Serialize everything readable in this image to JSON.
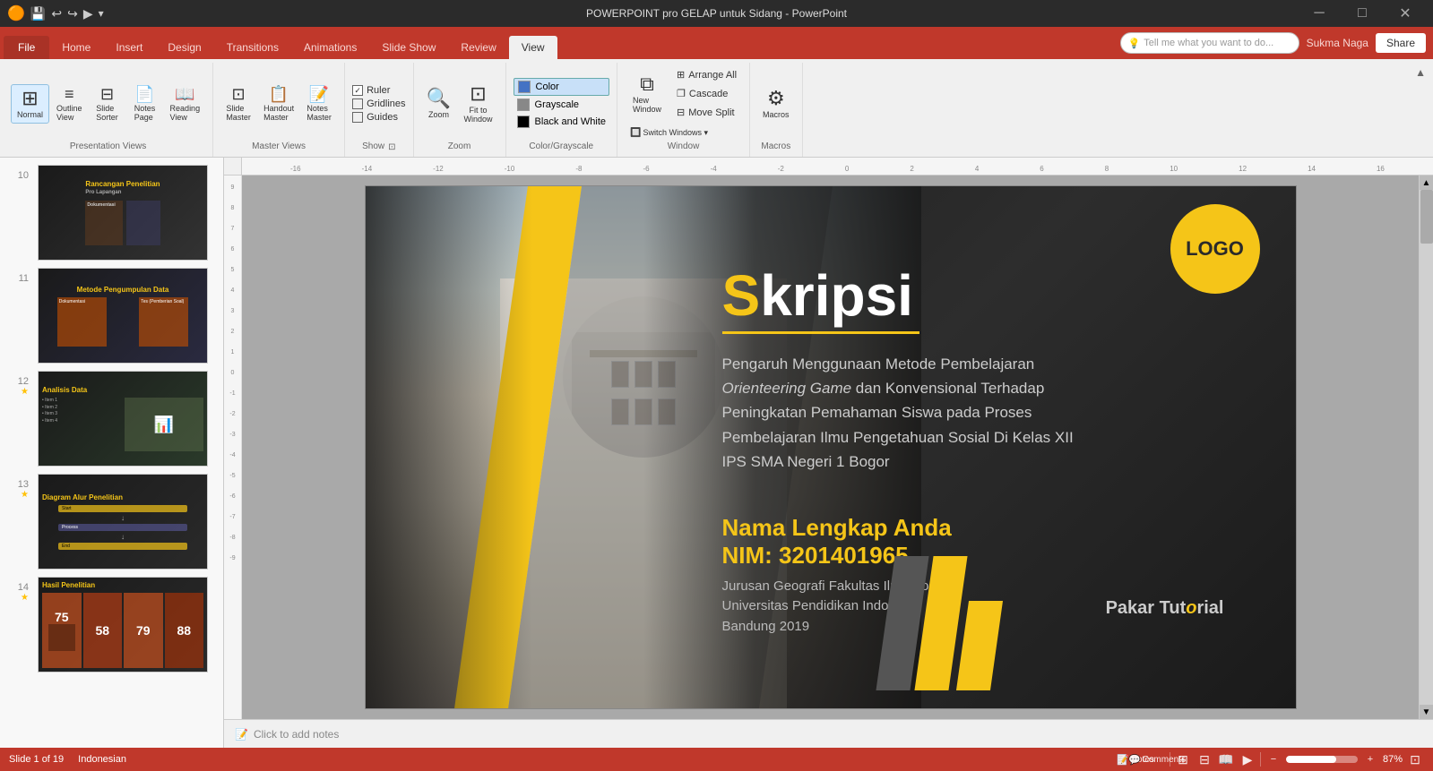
{
  "titlebar": {
    "title": "POWERPOINT pro GELAP untuk Sidang - PowerPoint",
    "minimize": "─",
    "maximize": "□",
    "close": "✕"
  },
  "ribbon": {
    "tabs": [
      "File",
      "Home",
      "Insert",
      "Design",
      "Transitions",
      "Animations",
      "Slide Show",
      "Review",
      "View"
    ],
    "active_tab": "View",
    "tell_me": "Tell me what you want to do...",
    "user": "Sukma Naga",
    "share": "Share",
    "groups": {
      "presentation_views": {
        "label": "Presentation Views",
        "buttons": [
          {
            "id": "normal",
            "icon": "⊞",
            "label": "Normal"
          },
          {
            "id": "outline-view",
            "icon": "≡",
            "label": "Outline View"
          },
          {
            "id": "slide-sorter",
            "icon": "⊟",
            "label": "Slide Sorter"
          },
          {
            "id": "notes-page",
            "icon": "📄",
            "label": "Notes Page"
          },
          {
            "id": "reading-view",
            "icon": "📖",
            "label": "Reading View"
          }
        ]
      },
      "master_views": {
        "label": "Master Views",
        "buttons": [
          {
            "id": "slide-master",
            "icon": "⊡",
            "label": "Slide Master"
          },
          {
            "id": "handout-master",
            "icon": "📋",
            "label": "Handout Master"
          },
          {
            "id": "notes-master",
            "icon": "📝",
            "label": "Notes Master"
          }
        ]
      },
      "show": {
        "label": "Show",
        "checkboxes": [
          {
            "id": "ruler",
            "label": "Ruler",
            "checked": true
          },
          {
            "id": "gridlines",
            "label": "Gridlines",
            "checked": false
          },
          {
            "id": "guides",
            "label": "Guides",
            "checked": false
          }
        ]
      },
      "zoom": {
        "label": "Zoom",
        "buttons": [
          {
            "id": "zoom-btn",
            "icon": "🔍",
            "label": "Zoom"
          },
          {
            "id": "fit-to-window",
            "icon": "⊡",
            "label": "Fit to Window"
          }
        ]
      },
      "color": {
        "label": "Color/Grayscale",
        "items": [
          {
            "id": "color",
            "label": "Color",
            "active": true,
            "dot": "#4472c4"
          },
          {
            "id": "grayscale",
            "label": "Grayscale",
            "active": false,
            "dot": "#888"
          },
          {
            "id": "black-white",
            "label": "Black and White",
            "active": false,
            "dot": "#000"
          }
        ]
      },
      "window": {
        "label": "Window",
        "buttons": [
          {
            "id": "new-window",
            "icon": "⧉",
            "label": "New Window"
          },
          {
            "id": "arrange-all",
            "icon": "⊞",
            "label": "Arrange All"
          },
          {
            "id": "cascade",
            "icon": "❐",
            "label": "Cascade"
          },
          {
            "id": "move-split",
            "icon": "⊟",
            "label": "Move Split"
          },
          {
            "id": "switch-windows",
            "icon": "🔲",
            "label": "Switch Windows"
          }
        ]
      },
      "macros": {
        "label": "Macros",
        "buttons": [
          {
            "id": "macros-btn",
            "icon": "⚙",
            "label": "Macros"
          }
        ]
      }
    }
  },
  "notes_label": "Notes",
  "slide_panel": {
    "slides": [
      {
        "num": 10,
        "star": false,
        "label": "Rancangan Penelitian",
        "sub": "Pro Lapangan"
      },
      {
        "num": 11,
        "star": false,
        "label": "Metode Pengumpulan Data",
        "sub": ""
      },
      {
        "num": 12,
        "star": true,
        "label": "Analisis Data",
        "sub": ""
      },
      {
        "num": 13,
        "star": true,
        "label": "Diagram Alur Penelitian",
        "sub": ""
      },
      {
        "num": 14,
        "star": true,
        "label": "Hasil Penelitian",
        "sub": ""
      }
    ]
  },
  "main_slide": {
    "logo_text": "LOGO",
    "title_s": "S",
    "title_rest": "kripsi",
    "subtitle": "Pengaruh Menggunaan Metode Pembelajaran ",
    "subtitle_italic": "Orienteering Game",
    "subtitle_rest": " dan Konvensional Terhadap Peningkatan Pemahaman Siswa pada Proses Pembelajaran Ilmu Pengetahuan Sosial Di Kelas XII IPS SMA Negeri 1 Bogor",
    "name": "Nama Lengkap Anda",
    "nim": "NIM: 3201401965",
    "affiliation1": "Jurusan Geografi  Fakultas Ilmu Sosial",
    "affiliation2": "Universitas Pendidikan Indonesia",
    "affiliation3": "Bandung 2019",
    "pakar": "Pakar",
    "tutorial": "Tut",
    "tutorial2": "o",
    "tutorial3": "rial"
  },
  "statusbar": {
    "slide_info": "Slide 1 of 19",
    "language": "Indonesian",
    "notes": "Notes",
    "comments": "Comments",
    "zoom": "87%",
    "view_normal": "Normal",
    "view_slidesorter": "Slide Sorter",
    "view_reading": "Reading"
  }
}
